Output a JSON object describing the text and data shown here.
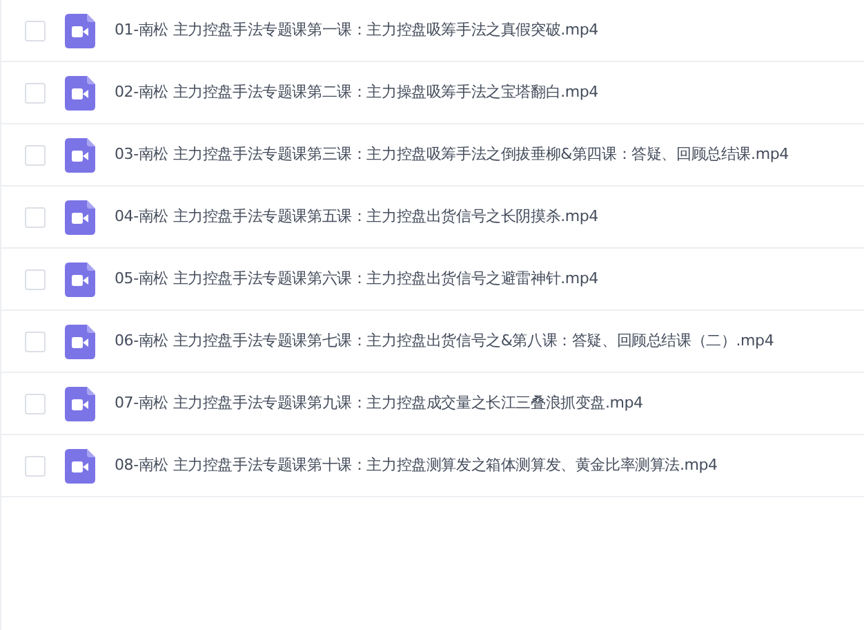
{
  "files": [
    {
      "name": "01-南松 主力控盘手法专题课第一课：主力控盘吸筹手法之真假突破.mp4",
      "checked": false
    },
    {
      "name": "02-南松 主力控盘手法专题课第二课：主力操盘吸筹手法之宝塔翻白.mp4",
      "checked": false
    },
    {
      "name": "03-南松 主力控盘手法专题课第三课：主力控盘吸筹手法之倒拔垂柳&第四课：答疑、回顾总结课.mp4",
      "checked": false
    },
    {
      "name": "04-南松 主力控盘手法专题课第五课：主力控盘出货信号之长阴摸杀.mp4",
      "checked": false
    },
    {
      "name": "05-南松 主力控盘手法专题课第六课：主力控盘出货信号之避雷神针.mp4",
      "checked": false
    },
    {
      "name": "06-南松 主力控盘手法专题课第七课：主力控盘出货信号之&第八课：答疑、回顾总结课（二）.mp4",
      "checked": false
    },
    {
      "name": "07-南松 主力控盘手法专题课第九课：主力控盘成交量之长江三叠浪抓变盘.mp4",
      "checked": false
    },
    {
      "name": "08-南松 主力控盘手法专题课第十课：主力控盘测算发之箱体测算发、黄金比率测算法.mp4",
      "checked": false
    }
  ]
}
